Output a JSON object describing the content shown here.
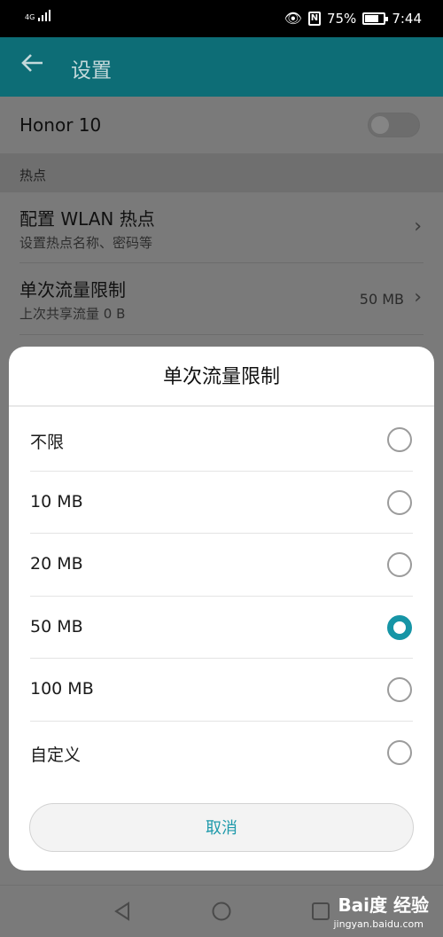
{
  "status_bar": {
    "network": "4G",
    "battery": "75%",
    "battery_level": 0.75,
    "time": "7:44"
  },
  "app_bar": {
    "back_icon": "arrow-left-icon",
    "title": "设置"
  },
  "page": {
    "device_name": "Honor 10",
    "device_toggle_on": false,
    "section_header": "热点",
    "rows": [
      {
        "title": "配置 WLAN 热点",
        "subtitle": "设置热点名称、密码等",
        "value": ""
      },
      {
        "title": "单次流量限制",
        "subtitle": "上次共享流量 0 B",
        "value": "50 MB"
      }
    ]
  },
  "dialog": {
    "title": "单次流量限制",
    "options": [
      {
        "label": "不限",
        "checked": false
      },
      {
        "label": "10 MB",
        "checked": false
      },
      {
        "label": "20 MB",
        "checked": false
      },
      {
        "label": "50 MB",
        "checked": true
      },
      {
        "label": "100 MB",
        "checked": false
      },
      {
        "label": "自定义",
        "checked": false
      }
    ],
    "cancel_label": "取消"
  },
  "watermark": {
    "brand": "Bai度 经验",
    "url": "jingyan.baidu.com"
  },
  "colors": {
    "accent": "#1695a6",
    "app_bar": "#0d6d76"
  }
}
